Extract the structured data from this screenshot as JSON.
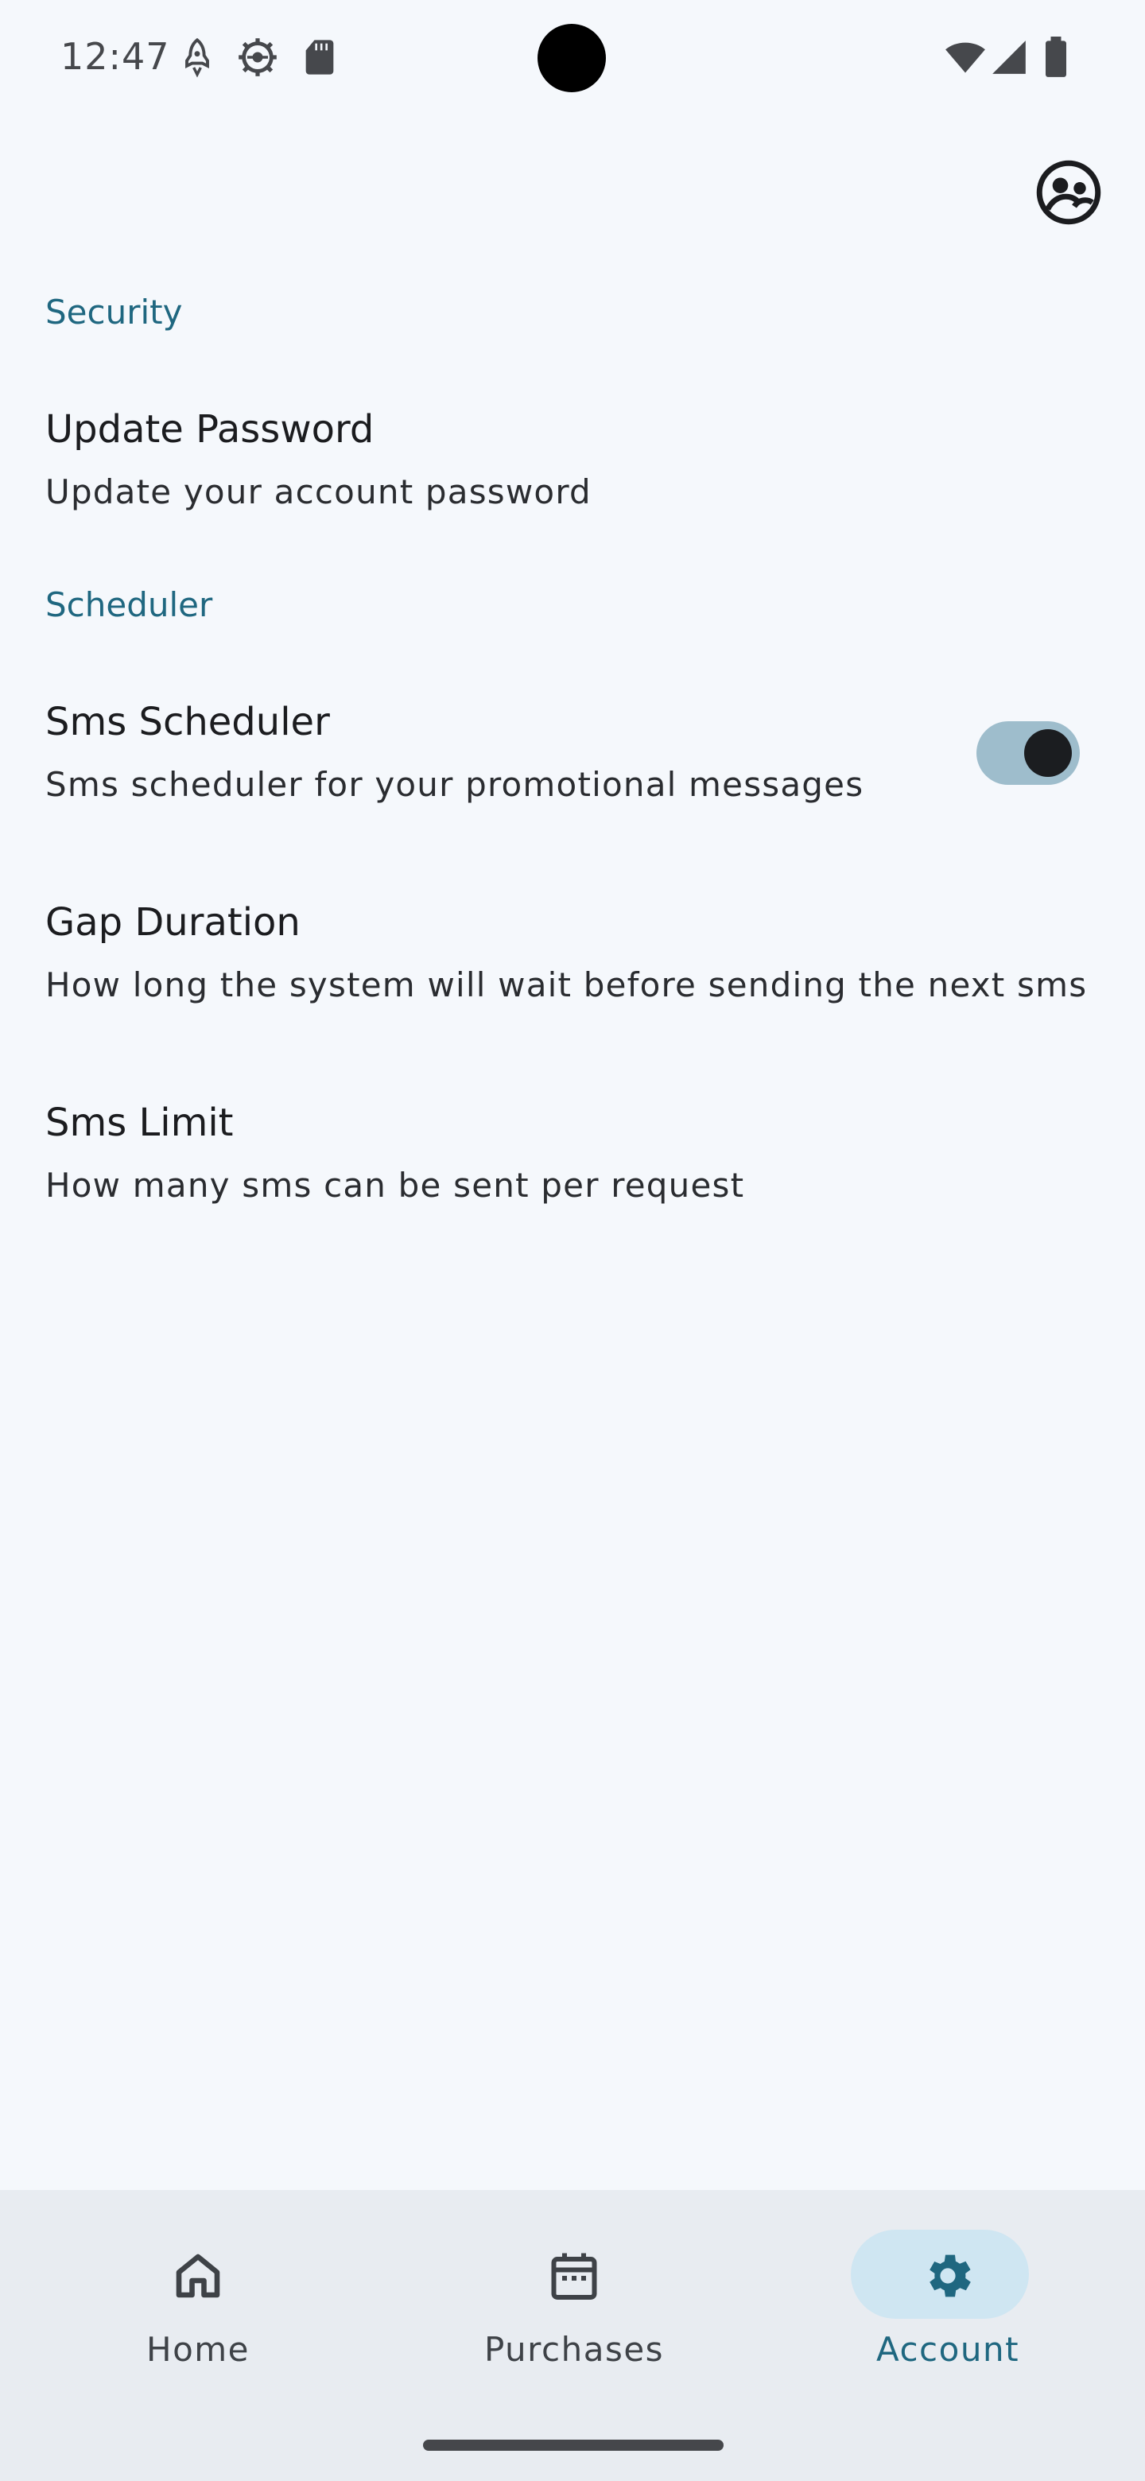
{
  "status_bar": {
    "time": "12:47",
    "icons": [
      "rocket-icon",
      "gear-badge-icon",
      "sd-card-icon",
      "wifi-icon",
      "signal-icon",
      "battery-icon"
    ]
  },
  "sections": {
    "security": {
      "title": "Security",
      "items": [
        {
          "title": "Update Password",
          "summary": "Update your account password"
        }
      ]
    },
    "scheduler": {
      "title": "Scheduler",
      "items": [
        {
          "title": "Sms Scheduler",
          "summary": "Sms scheduler for your promotional messages",
          "toggle_on": true
        },
        {
          "title": "Gap Duration",
          "summary": "How long the system will wait before sending the next sms"
        },
        {
          "title": "Sms Limit",
          "summary": "How many sms can be sent per request"
        }
      ]
    }
  },
  "bottom_nav": {
    "items": [
      {
        "label": "Home",
        "icon": "home-icon",
        "active": false
      },
      {
        "label": "Purchases",
        "icon": "calendar-icon",
        "active": false
      },
      {
        "label": "Account",
        "icon": "settings-icon",
        "active": true
      }
    ]
  },
  "colors": {
    "accent": "#1f6780",
    "background": "#f5f8fc",
    "nav_background": "#e8ecf1",
    "active_pill": "#cfe6f2",
    "switch_track": "#9ebdcc"
  }
}
